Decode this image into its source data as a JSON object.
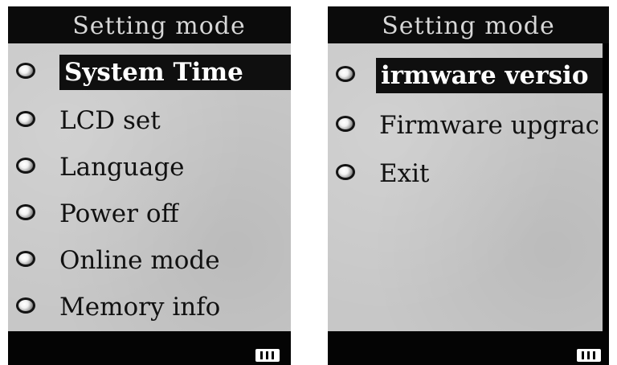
{
  "screens": [
    {
      "title": "Setting mode",
      "items": [
        {
          "label": "System Time",
          "selected": true
        },
        {
          "label": "LCD set",
          "selected": false
        },
        {
          "label": "Language",
          "selected": false
        },
        {
          "label": "Power off",
          "selected": false
        },
        {
          "label": "Online mode",
          "selected": false
        },
        {
          "label": "Memory info",
          "selected": false
        }
      ],
      "battery_icon": "battery-icon"
    },
    {
      "title": "Setting mode",
      "items": [
        {
          "label": "irmware versio",
          "selected": true
        },
        {
          "label": "Firmware upgrac",
          "selected": false
        },
        {
          "label": "Exit",
          "selected": false
        }
      ],
      "battery_icon": "battery-icon"
    }
  ]
}
